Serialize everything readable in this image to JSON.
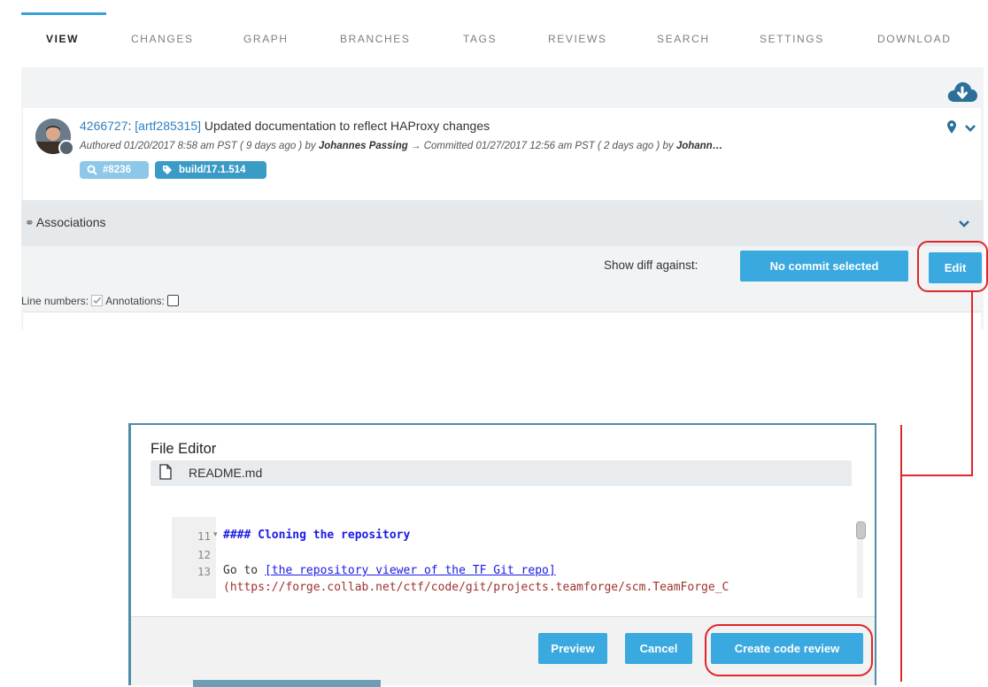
{
  "tabs": [
    "VIEW",
    "CHANGES",
    "GRAPH",
    "BRANCHES",
    "TAGS",
    "REVIEWS",
    "SEARCH",
    "SETTINGS",
    "DOWNLOAD"
  ],
  "commit": {
    "id": "4266727",
    "artifact": "[artf285315]",
    "message": "Updated documentation to reflect HAProxy changes",
    "authored_prefix": "Authored",
    "authored_date": "01/20/2017 8:58 am PST ( 9 days ago ) by",
    "author": "Johannes Passing",
    "committed_text": "→ Committed 01/27/2017 12:56 am PST ( 2 days ago ) by",
    "committer": "Johann…",
    "badge_review": "#8236",
    "badge_tag": "build/17.1.514"
  },
  "associations": {
    "label": "Associations"
  },
  "diff": {
    "label": "Show diff against:",
    "no_commit": "No commit selected",
    "edit": "Edit"
  },
  "options": {
    "line_numbers": "Line numbers:",
    "annotations": "Annotations:"
  },
  "editor": {
    "title": "File Editor",
    "file_name": "README.md",
    "lines": [
      {
        "num": "11",
        "text": "#### Cloning the repository"
      },
      {
        "num": "12",
        "text": ""
      },
      {
        "num": "13",
        "text_prefix": "Go to ",
        "link": "[the repository viewer of the TF Git repo]",
        "url": "(https://forge.collab.net/ctf/code/git/projects.teamforge/scm.TeamForge_C"
      }
    ],
    "preview": "Preview",
    "cancel": "Cancel",
    "create_review": "Create code review"
  },
  "colors": {
    "accent": "#3aa9e0",
    "annotation_red": "#e0262a",
    "link": "#2f7fc1"
  },
  "icons": [
    "cloud-download-icon",
    "map-pin-icon",
    "chevron-down-icon",
    "search-icon",
    "tag-icon",
    "link-icon",
    "file-icon",
    "fold-arrow-icon"
  ]
}
